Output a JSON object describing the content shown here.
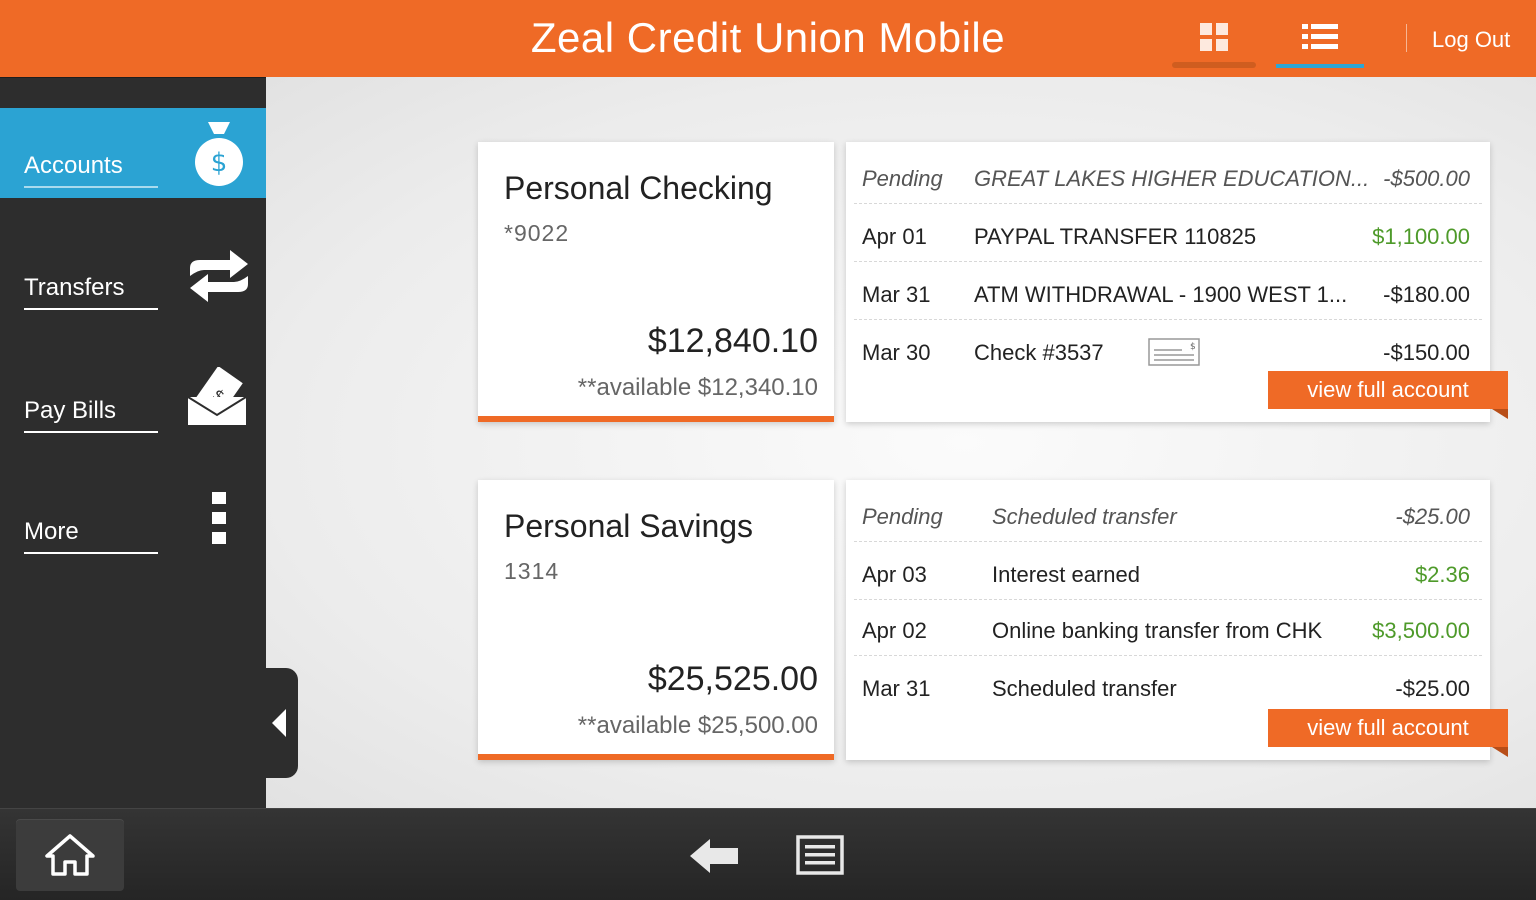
{
  "header": {
    "title": "Zeal Credit Union Mobile",
    "logout_label": "Log Out",
    "grid_view_icon": "grid-icon",
    "list_view_icon": "list-icon"
  },
  "sidebar": {
    "items": [
      {
        "label": "Accounts",
        "icon": "money-bag-icon",
        "active": true
      },
      {
        "label": "Transfers",
        "icon": "transfer-arrows-icon",
        "active": false
      },
      {
        "label": "Pay Bills",
        "icon": "bill-envelope-icon",
        "active": false
      },
      {
        "label": "More",
        "icon": "more-vertical-icon",
        "active": false
      }
    ]
  },
  "accounts": [
    {
      "name": "Personal Checking",
      "number": "*9022",
      "balance": "$12,840.10",
      "available": "**available $12,340.10",
      "view_full_label": "view full account",
      "transactions": [
        {
          "date": "Pending",
          "description": "GREAT LAKES HIGHER EDUCATION...",
          "amount": "-$500.00",
          "pending": true
        },
        {
          "date": "Apr 01",
          "description": "PAYPAL TRANSFER 110825",
          "amount": "$1,100.00",
          "credit": true
        },
        {
          "date": "Mar 31",
          "description": "ATM WITHDRAWAL - 1900 WEST 1...",
          "amount": "-$180.00"
        },
        {
          "date": "Mar 30",
          "description": "Check #3537",
          "amount": "-$150.00",
          "has_check_icon": true
        }
      ]
    },
    {
      "name": "Personal Savings",
      "number": "1314",
      "balance": "$25,525.00",
      "available": "**available $25,500.00",
      "view_full_label": "view full account",
      "transactions": [
        {
          "date": "Pending",
          "description": "Scheduled transfer",
          "amount": "-$25.00",
          "pending": true
        },
        {
          "date": "Apr 03",
          "description": "Interest earned",
          "amount": "$2.36",
          "credit": true
        },
        {
          "date": "Apr 02",
          "description": "Online banking transfer from CHK",
          "amount": "$3,500.00",
          "credit": true
        },
        {
          "date": "Mar 31",
          "description": "Scheduled transfer",
          "amount": "-$25.00"
        }
      ]
    }
  ],
  "colors": {
    "brand_orange": "#ef6a26",
    "active_blue": "#2ba3d3",
    "credit_green": "#4e9a2a",
    "sidebar_dark": "#2d2d2d"
  },
  "bottombar": {
    "home_icon": "home-icon",
    "back_icon": "back-arrow-icon",
    "menu_icon": "menu-icon"
  }
}
